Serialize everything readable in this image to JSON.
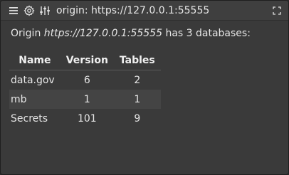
{
  "window": {
    "title": "origin: https://127.0.0.1:55555",
    "icons": [
      "menu-icon",
      "gear-icon",
      "sliders-icon",
      "fullscreen-icon"
    ]
  },
  "summary": {
    "prefix": "Origin ",
    "origin": "https://127.0.0.1:55555",
    "suffix": " has 3 databases:"
  },
  "table": {
    "headers": [
      "Name",
      "Version",
      "Tables"
    ],
    "rows": [
      {
        "name": "data.gov",
        "version": "6",
        "tables": "2"
      },
      {
        "name": "mb",
        "version": "1",
        "tables": "1"
      },
      {
        "name": "Secrets",
        "version": "101",
        "tables": "9"
      }
    ]
  },
  "colors": {
    "panel": "#3a3a3a",
    "titlebar": "#3f3f3f",
    "row_alt": "#444444",
    "text": "#e6e6e6"
  }
}
